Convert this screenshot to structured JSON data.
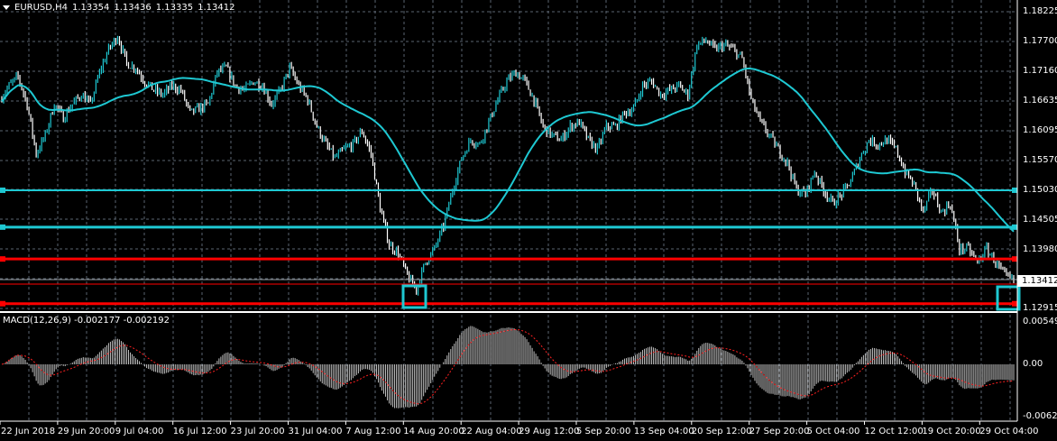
{
  "header": {
    "symbol": "EURUSD,H4",
    "open": "1.13354",
    "high": "1.13436",
    "low": "1.13335",
    "close": "1.13412"
  },
  "macd": {
    "label": "MACD(12,26,9)",
    "main": "-0.002177",
    "signal": "-0.002192",
    "axis_top": "0.005499",
    "axis_zero": "0.00",
    "axis_bottom": "-0.006272"
  },
  "price_axis": [
    "1.18225",
    "1.17700",
    "1.17160",
    "1.16635",
    "1.16095",
    "1.15570",
    "1.15030",
    "1.14505",
    "1.13980",
    "1.12915"
  ],
  "current_price": "1.13412",
  "time_axis": [
    "22 Jun 2018",
    "29 Jun 20:00",
    "9 Jul 04:00",
    "16 Jul 12:00",
    "23 Jul 20:00",
    "31 Jul 04:00",
    "7 Aug 12:00",
    "14 Aug 20:00",
    "22 Aug 04:00",
    "29 Aug 12:00",
    "5 Sep 20:00",
    "13 Sep 04:00",
    "20 Sep 12:00",
    "27 Sep 20:00",
    "5 Oct 04:00",
    "12 Oct 12:00",
    "19 Oct 20:00",
    "29 Oct 04:00"
  ],
  "colors": {
    "up": "#1ec8d2",
    "down": "#ffffff",
    "ma": "#1ec8d2",
    "support": "#1ec8d2",
    "resistance": "#ff0000",
    "grid": "#5a6470",
    "histogram": "#c0c0c0",
    "signal": "#ff2020"
  },
  "levels": [
    {
      "price": 1.1503,
      "color": "#1ec8d2",
      "width": 2
    },
    {
      "price": 1.1437,
      "color": "#1ec8d2",
      "width": 3
    },
    {
      "price": 1.138,
      "color": "#ff0000",
      "width": 3
    },
    {
      "price": 1.13,
      "color": "#ff0000",
      "width": 3
    }
  ],
  "chart_data": {
    "type": "candlestick",
    "symbol": "EURUSD",
    "timeframe": "H4",
    "ylim": [
      1.12915,
      1.18225
    ],
    "closes": [
      1.1665,
      1.169,
      1.1706,
      1.1657,
      1.1568,
      1.1601,
      1.1657,
      1.1633,
      1.1657,
      1.1674,
      1.1657,
      1.1714,
      1.1755,
      1.1779,
      1.173,
      1.1722,
      1.1698,
      1.1682,
      1.1674,
      1.169,
      1.1682,
      1.1641,
      1.1649,
      1.1657,
      1.1714,
      1.1722,
      1.169,
      1.1682,
      1.1698,
      1.169,
      1.1657,
      1.1682,
      1.1722,
      1.169,
      1.1665,
      1.1617,
      1.1585,
      1.156,
      1.1576,
      1.1585,
      1.1609,
      1.1568,
      1.1471,
      1.1406,
      1.139,
      1.135,
      1.1325,
      1.1374,
      1.1398,
      1.1439,
      1.1504,
      1.156,
      1.1593,
      1.1585,
      1.1625,
      1.1665,
      1.1698,
      1.1714,
      1.1698,
      1.1665,
      1.1617,
      1.1601,
      1.1593,
      1.1617,
      1.1625,
      1.1593,
      1.1576,
      1.1617,
      1.1617,
      1.1641,
      1.1649,
      1.169,
      1.1698,
      1.1674,
      1.1682,
      1.169,
      1.1674,
      1.1763,
      1.1771,
      1.1755,
      1.1763,
      1.1755,
      1.1738,
      1.1665,
      1.1625,
      1.1601,
      1.1576,
      1.1552,
      1.1504,
      1.1496,
      1.1536,
      1.1504,
      1.1479,
      1.1496,
      1.152,
      1.156,
      1.1593,
      1.1585,
      1.1593,
      1.1576,
      1.1536,
      1.1512,
      1.1463,
      1.1504,
      1.1463,
      1.1479,
      1.1398,
      1.1398,
      1.1374,
      1.1398,
      1.1374,
      1.135,
      1.1341
    ],
    "macd_ylim": [
      -0.006272,
      0.005499
    ]
  }
}
